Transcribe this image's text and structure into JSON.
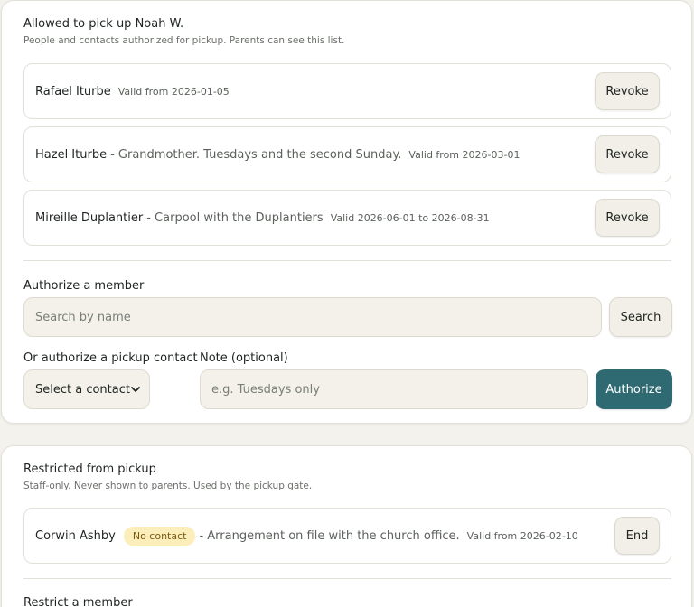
{
  "allowed": {
    "title": "Allowed to pick up Noah W.",
    "subtitle": "People and contacts authorized for pickup. Parents can see this list.",
    "entries": [
      {
        "name": "Rafael Iturbe",
        "note": "",
        "validity": "Valid from 2026-01-05",
        "action": "Revoke"
      },
      {
        "name": "Hazel Iturbe",
        "note": "- Grandmother. Tuesdays and the second Sunday.",
        "validity": "Valid from 2026-03-01",
        "action": "Revoke"
      },
      {
        "name": "Mireille Duplantier",
        "note": "- Carpool with the Duplantiers",
        "validity": "Valid 2026-06-01 to 2026-08-31",
        "action": "Revoke"
      }
    ]
  },
  "authorize_member": {
    "label": "Authorize a member",
    "search_placeholder": "Search by name",
    "search_button": "Search"
  },
  "authorize_contact": {
    "label": "Or authorize a pickup contact",
    "select_value": "Select a contact",
    "note_label": "Note (optional)",
    "note_placeholder": "e.g. Tuesdays only",
    "submit": "Authorize"
  },
  "restricted": {
    "title": "Restricted from pickup",
    "subtitle": "Staff-only. Never shown to parents. Used by the pickup gate.",
    "entries": [
      {
        "name": "Corwin Ashby",
        "badge": "No contact",
        "note": "- Arrangement on file with the church office.",
        "validity": "Valid from 2026-02-10",
        "action": "End"
      }
    ],
    "restrict_label": "Restrict a member"
  },
  "colors": {
    "accent": "#2f6a73",
    "badge_bg": "#fbeebb",
    "badge_text": "#7a5a10",
    "page_bg": "#f4f2ec"
  }
}
